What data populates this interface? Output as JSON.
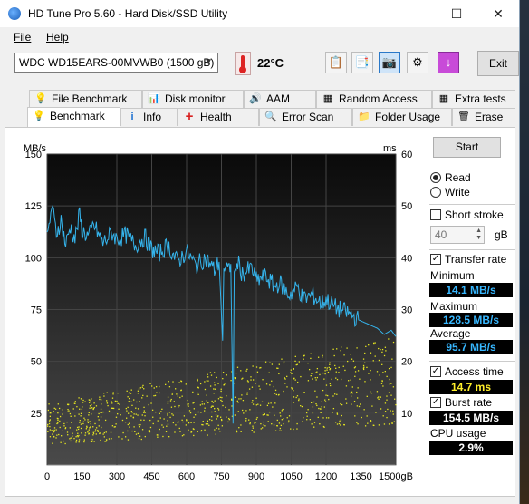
{
  "window": {
    "title": "HD Tune Pro 5.60 - Hard Disk/SSD Utility",
    "minimize": "—",
    "maximize": "☐",
    "close": "✕"
  },
  "menu": {
    "file": "File",
    "help": "Help"
  },
  "toolbar": {
    "drive": "WDC WD15EARS-00MVWB0 (1500 gB)",
    "temperature": "22°C",
    "exit_label": "Exit"
  },
  "tabs_top": [
    "File Benchmark",
    "Disk monitor",
    "AAM",
    "Random Access",
    "Extra tests"
  ],
  "tabs_bottom": [
    "Benchmark",
    "Info",
    "Health",
    "Error Scan",
    "Folder Usage",
    "Erase"
  ],
  "controls": {
    "start_label": "Start",
    "read_label": "Read",
    "write_label": "Write",
    "mode": "read",
    "short_stroke_label": "Short stroke",
    "short_stroke_checked": false,
    "short_stroke_value": "40",
    "short_stroke_unit": "gB",
    "transfer_rate_label": "Transfer rate",
    "transfer_rate_checked": true,
    "access_time_label": "Access time",
    "access_time_checked": true,
    "burst_rate_label": "Burst rate",
    "burst_rate_checked": true,
    "cpu_usage_label": "CPU usage"
  },
  "results": {
    "minimum_label": "Minimum",
    "minimum": "14.1 MB/s",
    "maximum_label": "Maximum",
    "maximum": "128.5 MB/s",
    "average_label": "Average",
    "average": "95.7 MB/s",
    "access_time": "14.7 ms",
    "burst_rate": "154.5 MB/s",
    "cpu_usage": "2.9%"
  },
  "chart_data": {
    "type": "line",
    "y_left_label": "MB/s",
    "y_right_label": "ms",
    "x_unit": "gB",
    "xlim": [
      0,
      1500
    ],
    "ylim_left": [
      0,
      150
    ],
    "ylim_right": [
      0,
      60
    ],
    "x_ticks": [
      0,
      150,
      300,
      450,
      600,
      750,
      900,
      1050,
      1200,
      1350,
      1500
    ],
    "y_left_ticks": [
      25,
      50,
      75,
      100,
      125,
      150
    ],
    "y_right_ticks": [
      10,
      20,
      30,
      40,
      50,
      60
    ],
    "colors": {
      "transfer": "#35b4ec",
      "access": "#e8e820",
      "background": "#141414",
      "grid": "#444444"
    },
    "series": [
      {
        "kind": "transfer",
        "x": [
          0,
          20,
          40,
          60,
          80,
          100,
          120,
          140,
          150,
          180,
          200,
          240,
          280,
          300,
          340,
          380,
          420,
          450,
          480,
          520,
          560,
          600,
          640,
          680,
          700,
          720,
          740,
          755,
          760,
          770,
          780,
          790,
          800,
          805,
          810,
          820,
          840,
          880,
          900,
          940,
          980,
          1000,
          1040,
          1080,
          1100,
          1140,
          1180,
          1200,
          1240,
          1280,
          1300,
          1340,
          1380,
          1420,
          1450,
          1480,
          1500
        ],
        "y": [
          108,
          125,
          112,
          118,
          106,
          115,
          109,
          121,
          113,
          110,
          116,
          107,
          112,
          109,
          111,
          106,
          110,
          104,
          102,
          106,
          98,
          103,
          96,
          100,
          97,
          94,
          98,
          60,
          95,
          96,
          93,
          97,
          20,
          96,
          92,
          98,
          92,
          95,
          89,
          91,
          86,
          88,
          82,
          86,
          80,
          82,
          78,
          80,
          76,
          74,
          73,
          70,
          68,
          66,
          63,
          65,
          62
        ]
      },
      {
        "kind": "access",
        "x_range": [
          0,
          1500
        ],
        "y_range_ms": [
          4,
          25
        ],
        "trend": "rising"
      }
    ]
  }
}
